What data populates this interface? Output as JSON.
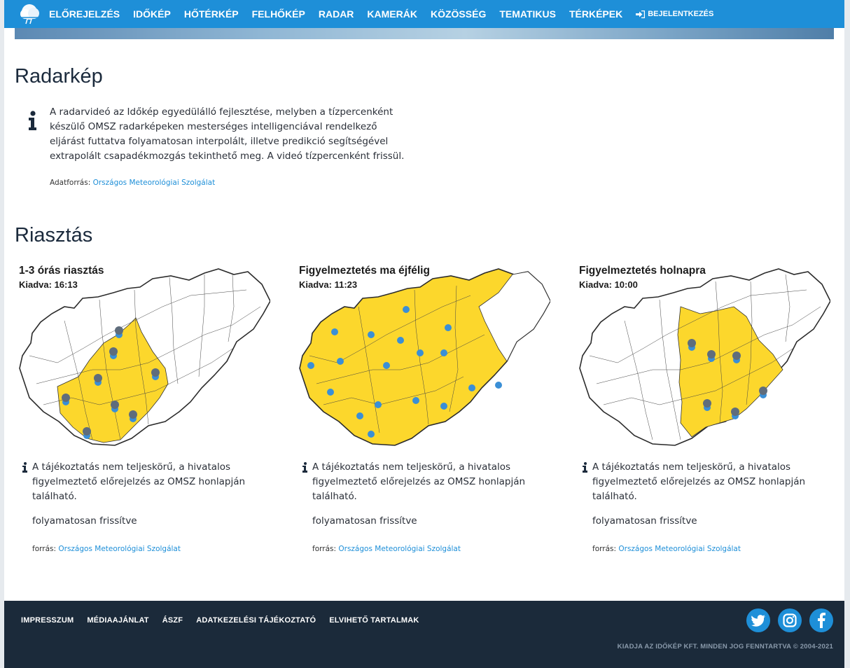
{
  "nav": {
    "items": [
      "ELŐREJELZÉS",
      "IDŐKÉP",
      "HŐTÉRKÉP",
      "FELHŐKÉP",
      "RADAR",
      "KAMERÁK",
      "KÖZÖSSÉG",
      "TEMATIKUS",
      "TÉRKÉPEK"
    ],
    "login_label": "BEJELENTKEZÉS",
    "logo_icon": "weather-cloud-logo-icon",
    "login_icon": "sign-in-icon"
  },
  "radar": {
    "title": "Radarkép",
    "description": "A radarvideó az Időkép egyedülálló fejlesztése, melyben a tízpercenként készülő OMSZ radarképeken mesterséges intelligenciával rendelkező eljárást futtatva folyamatosan interpolált, illetve predikció segítségével extrapolált csapadékmozgás tekinthető meg. A videó tízpercenként frissül.",
    "source_label": "Adatforrás:",
    "source_link": "Országos Meteorológiai Szolgálat",
    "icon": "info-icon"
  },
  "alerts": {
    "title": "Riasztás",
    "cards": [
      {
        "map_title": "1-3 órás riasztás",
        "map_sub": "Kiadva: 16:13",
        "info": "A tájékoztatás nem teljeskörű, a hivatalos figyelmeztető előrejelzés az OMSZ honlapján található.",
        "status": "folyamatosan frissítve",
        "source_label": "forrás:",
        "source_link": "Országos Meteorológiai Szolgálat"
      },
      {
        "map_title": "Figyelmeztetés ma éjfélig",
        "map_sub": "Kiadva: 11:23",
        "info": "A tájékoztatás nem teljeskörű, a hivatalos figyelmeztető előrejelzés az OMSZ honlapján található.",
        "status": "folyamatosan frissítve",
        "source_label": "forrás:",
        "source_link": "Országos Meteorológiai Szolgálat"
      },
      {
        "map_title": "Figyelmeztetés holnapra",
        "map_sub": "Kiadva: 10:00",
        "info": "A tájékoztatás nem teljeskörű, a hivatalos figyelmeztető előrejelzés az OMSZ honlapján található.",
        "status": "folyamatosan frissítve",
        "source_label": "forrás:",
        "source_link": "Országos Meteorológiai Szolgálat"
      }
    ],
    "warning_color": "#fcd72c",
    "map_border_color": "#2b2b2b",
    "rain_icon_color": "#3a8fd6"
  },
  "footer": {
    "links": [
      "IMPRESSZUM",
      "MÉDIAAJÁNLAT",
      "ÁSZF",
      "ADATKEZELÉSI TÁJÉKOZTATÓ",
      "ELVIHETŐ TARTALMAK"
    ],
    "copyright": "KIADJA AZ IDŐKÉP KFT. MINDEN JOG FENNTARTVA © 2004-2021",
    "social_icons": [
      "twitter-icon",
      "instagram-icon",
      "facebook-icon"
    ]
  },
  "colors": {
    "brand": "#1e8fd8",
    "footer_bg": "#1b2a3a"
  }
}
